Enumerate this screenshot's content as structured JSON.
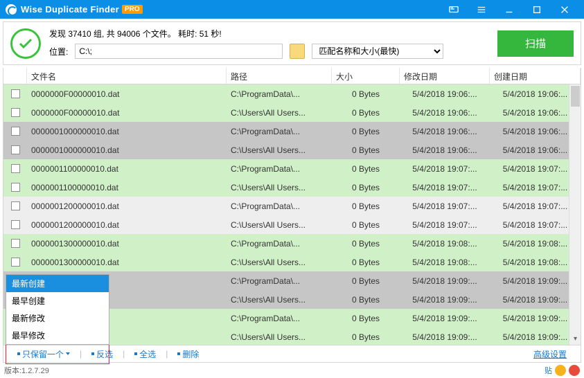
{
  "titlebar": {
    "title": "Wise Duplicate Finder",
    "pro": "PRO"
  },
  "summary": {
    "line1": "发现 37410 组, 共 94006 个文件。 耗时: 51 秒!",
    "loc_label": "位置:",
    "loc_value": "C:\\;",
    "match_selected": "匹配名称和大小(最快)",
    "scan": "扫描"
  },
  "columns": {
    "name": "文件名",
    "path": "路径",
    "size": "大小",
    "mod": "修改日期",
    "crt": "创建日期"
  },
  "rows": [
    {
      "g": "g-green",
      "name": "0000000F00000010.dat",
      "path": "C:\\ProgramData\\...",
      "size": "0 Bytes",
      "mod": "5/4/2018 19:06:...",
      "crt": "5/4/2018 19:06:..."
    },
    {
      "g": "g-green",
      "name": "0000000F00000010.dat",
      "path": "C:\\Users\\All Users...",
      "size": "0 Bytes",
      "mod": "5/4/2018 19:06:...",
      "crt": "5/4/2018 19:06:..."
    },
    {
      "g": "g-gray",
      "name": "0000001000000010.dat",
      "path": "C:\\ProgramData\\...",
      "size": "0 Bytes",
      "mod": "5/4/2018 19:06:...",
      "crt": "5/4/2018 19:06:..."
    },
    {
      "g": "g-gray",
      "name": "0000001000000010.dat",
      "path": "C:\\Users\\All Users...",
      "size": "0 Bytes",
      "mod": "5/4/2018 19:06:...",
      "crt": "5/4/2018 19:06:..."
    },
    {
      "g": "g-green",
      "name": "0000001100000010.dat",
      "path": "C:\\ProgramData\\...",
      "size": "0 Bytes",
      "mod": "5/4/2018 19:07:...",
      "crt": "5/4/2018 19:07:..."
    },
    {
      "g": "g-green",
      "name": "0000001100000010.dat",
      "path": "C:\\Users\\All Users...",
      "size": "0 Bytes",
      "mod": "5/4/2018 19:07:...",
      "crt": "5/4/2018 19:07:..."
    },
    {
      "g": "g-lgray",
      "name": "0000001200000010.dat",
      "path": "C:\\ProgramData\\...",
      "size": "0 Bytes",
      "mod": "5/4/2018 19:07:...",
      "crt": "5/4/2018 19:07:..."
    },
    {
      "g": "g-lgray",
      "name": "0000001200000010.dat",
      "path": "C:\\Users\\All Users...",
      "size": "0 Bytes",
      "mod": "5/4/2018 19:07:...",
      "crt": "5/4/2018 19:07:..."
    },
    {
      "g": "g-green",
      "name": "0000001300000010.dat",
      "path": "C:\\ProgramData\\...",
      "size": "0 Bytes",
      "mod": "5/4/2018 19:08:...",
      "crt": "5/4/2018 19:08:..."
    },
    {
      "g": "g-green",
      "name": "0000001300000010.dat",
      "path": "C:\\Users\\All Users...",
      "size": "0 Bytes",
      "mod": "5/4/2018 19:08:...",
      "crt": "5/4/2018 19:08:..."
    },
    {
      "g": "g-gray",
      "name": "dat",
      "path": "C:\\ProgramData\\...",
      "size": "0 Bytes",
      "mod": "5/4/2018 19:09:...",
      "crt": "5/4/2018 19:09:..."
    },
    {
      "g": "g-gray",
      "name": "dat",
      "path": "C:\\Users\\All Users...",
      "size": "0 Bytes",
      "mod": "5/4/2018 19:09:...",
      "crt": "5/4/2018 19:09:..."
    },
    {
      "g": "g-green",
      "name": "dat",
      "path": "C:\\ProgramData\\...",
      "size": "0 Bytes",
      "mod": "5/4/2018 19:09:...",
      "crt": "5/4/2018 19:09:..."
    },
    {
      "g": "g-green",
      "name": "dat",
      "path": "C:\\Users\\All Users...",
      "size": "0 Bytes",
      "mod": "5/4/2018 19:09:...",
      "crt": "5/4/2018 19:09:..."
    }
  ],
  "popup": {
    "items": [
      "最新创建",
      "最早创建",
      "最新修改",
      "最早修改"
    ],
    "selected": 0
  },
  "footer": {
    "keep_one": "只保留一个",
    "invert": "反选",
    "select_all": "全选",
    "delete": "删除",
    "advanced": "高级设置"
  },
  "status": {
    "version": "版本:1.2.7.29",
    "tip": "贴"
  }
}
